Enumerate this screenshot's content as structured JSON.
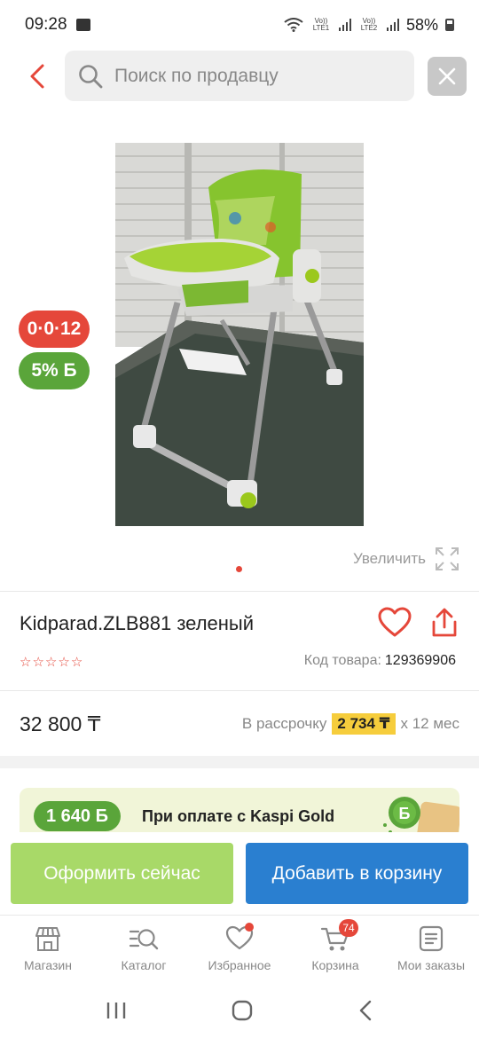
{
  "status_bar": {
    "time": "09:28",
    "battery": "58%",
    "sim1": "Vo)) LTE1",
    "sim2": "Vo)) LTE2"
  },
  "header": {
    "search_placeholder": "Поиск по продавцу"
  },
  "gallery": {
    "badge_installment": "0·0·12",
    "badge_bonus": "5% Б",
    "zoom_label": "Увеличить",
    "colors": {
      "installment": "#e5473a",
      "bonus": "#5aa53a"
    }
  },
  "product": {
    "title": "Kidparad.ZLB881 зеленый",
    "rating_stars": 0,
    "code_label": "Код товара:",
    "code": "129369906",
    "price": "32 800 ₸",
    "installment_label": "В рассрочку",
    "installment_amount": "2 734 ₸",
    "installment_term": "х 12 мес"
  },
  "gold_banner": {
    "bonus": "1 640 Б",
    "text": "При оплате с Kaspi Gold"
  },
  "actions": {
    "buy_now": "Оформить сейчас",
    "add_to_cart": "Добавить в корзину"
  },
  "bottom_nav": [
    {
      "label": "Магазин",
      "icon": "shop-icon"
    },
    {
      "label": "Каталог",
      "icon": "catalog-search-icon"
    },
    {
      "label": "Избранное",
      "icon": "heart-icon"
    },
    {
      "label": "Корзина",
      "icon": "cart-icon",
      "badge": "74"
    },
    {
      "label": "Мои заказы",
      "icon": "orders-icon"
    }
  ],
  "accent": "#e5473a"
}
